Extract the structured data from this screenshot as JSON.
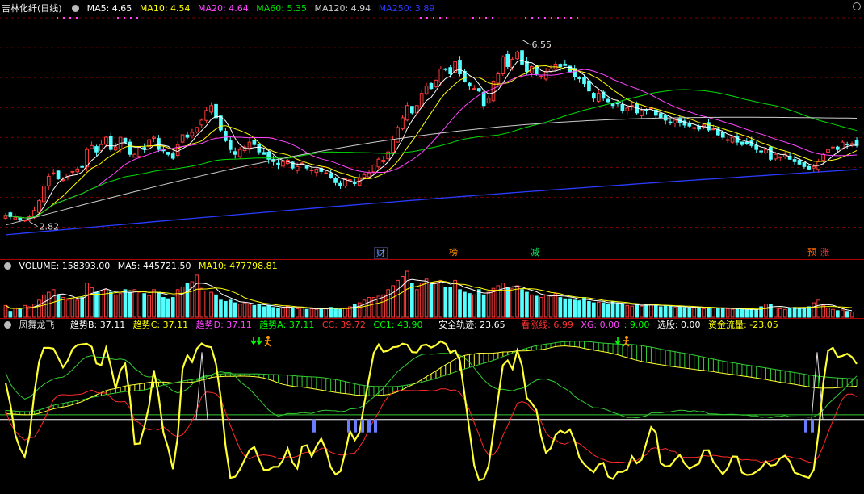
{
  "colors": {
    "up": "#ff3b3b",
    "down": "#54ffff",
    "ma5": "#ffffff",
    "ma10": "#ffff00",
    "ma20": "#ff44ff",
    "ma60": "#00dd00",
    "ma120": "#cccccc",
    "ma250": "#2a3cff",
    "grid": "#7a0000"
  },
  "price_panel": {
    "title": "吉林化纤(日线)",
    "ma5": "MA5: 4.65",
    "ma10": "MA10: 4.54",
    "ma20": "MA20: 4.64",
    "ma60": "MA60: 5.35",
    "ma120": "MA120: 4.94",
    "ma250": "MA250: 3.89",
    "high_label": "6.55",
    "low_label": "2.82",
    "events": [
      {
        "text": "财",
        "color": "#6aa0ff"
      },
      {
        "text": "榜",
        "color": "#ff8c00"
      },
      {
        "text": "减",
        "color": "#00ff66"
      },
      {
        "text": "预",
        "color": "#ff6600"
      },
      {
        "text": "涨",
        "color": "#ff3333"
      }
    ]
  },
  "volume_panel": {
    "label": "VOLUME: 158393.00",
    "ma5": "MA5: 445721.50",
    "ma10": "MA10: 477798.81"
  },
  "indicator_panel": {
    "name": "凤舞龙飞",
    "b": "趋势B: 37.11",
    "c": "趋势C: 37.11",
    "d": "趋势D: 37.11",
    "a": "趋势A: 37.11",
    "cc": "CC: 39.72",
    "cc1": "CC1: 43.90",
    "safe": "安全轨迹: 23.65",
    "bull": "看涨线: 6.99",
    "xg": "XG: 0.00",
    "blank": ": 9.00",
    "pick": "选股: 0.00",
    "fund": "资金流量: -23.05"
  },
  "chart_data": [
    {
      "type": "candlestick",
      "title": "吉林化纤(日线)",
      "closes": [
        2.95,
        2.92,
        2.9,
        2.86,
        2.85,
        2.92,
        3.05,
        3.25,
        3.55,
        3.75,
        3.82,
        3.7,
        3.68,
        3.8,
        3.85,
        3.9,
        3.95,
        4.3,
        4.38,
        4.25,
        4.4,
        4.55,
        4.3,
        4.35,
        4.55,
        4.45,
        4.2,
        4.2,
        4.35,
        4.3,
        4.5,
        4.55,
        4.3,
        4.28,
        4.2,
        4.12,
        4.4,
        4.6,
        4.55,
        4.65,
        4.75,
        4.9,
        5.1,
        5.2,
        4.95,
        4.7,
        4.48,
        4.3,
        4.2,
        4.3,
        4.35,
        4.45,
        4.4,
        4.25,
        4.2,
        4.1,
        4.05,
        3.98,
        4.05,
        4.08,
        3.92,
        3.95,
        4.02,
        3.92,
        3.88,
        3.9,
        3.85,
        3.82,
        3.72,
        3.62,
        3.55,
        3.7,
        3.68,
        3.6,
        3.72,
        3.78,
        3.82,
        3.98,
        4.1,
        4.08,
        4.25,
        4.5,
        4.75,
        4.95,
        5.2,
        5.05,
        5.2,
        5.45,
        5.6,
        5.55,
        5.72,
        5.95,
        5.95,
        5.85,
        6.1,
        5.85,
        5.7,
        5.6,
        5.55,
        5.5,
        5.2,
        5.35,
        5.7,
        5.85,
        6.2,
        6.0,
        6.15,
        6.3,
        6.05,
        5.9,
        6.0,
        5.85,
        5.8,
        5.9,
        5.95,
        6.05,
        6.0,
        6.02,
        5.9,
        5.8,
        5.75,
        5.65,
        5.5,
        5.35,
        5.45,
        5.35,
        5.28,
        5.2,
        5.25,
        5.1,
        5.15,
        5.2,
        5.05,
        5.1,
        5.1,
        5.15,
        5.0,
        4.95,
        4.9,
        4.85,
        4.9,
        4.85,
        4.8,
        4.78,
        4.75,
        4.72,
        4.8,
        4.7,
        4.72,
        4.6,
        4.55,
        4.5,
        4.55,
        4.45,
        4.4,
        4.42,
        4.38,
        4.3,
        4.25,
        4.3,
        4.1,
        4.2,
        4.15,
        4.2,
        4.1,
        4.05,
        4.0,
        3.95,
        3.9,
        3.95,
        4.05,
        4.2,
        4.3,
        4.35,
        4.3,
        4.45,
        4.4,
        4.42,
        4.38
      ],
      "high": 6.55,
      "low": 2.82,
      "ylim": [
        2.4,
        7.0
      ],
      "moving_averages": [
        "MA5",
        "MA10",
        "MA20",
        "MA60",
        "MA120",
        "MA250"
      ]
    },
    {
      "type": "bar",
      "title": "VOLUME",
      "volumes": [
        180,
        90,
        140,
        120,
        180,
        160,
        200,
        260,
        340,
        380,
        420,
        330,
        300,
        260,
        280,
        260,
        300,
        520,
        450,
        380,
        400,
        420,
        380,
        340,
        360,
        420,
        380,
        420,
        380,
        360,
        330,
        420,
        380,
        300,
        280,
        300,
        420,
        460,
        520,
        540,
        640,
        440,
        400,
        380,
        340,
        260,
        240,
        260,
        220,
        200,
        220,
        200,
        180,
        200,
        160,
        180,
        150,
        140,
        140,
        170,
        150,
        130,
        140,
        120,
        130,
        120,
        140,
        130,
        150,
        140,
        120,
        140,
        160,
        200,
        220,
        260,
        300,
        300,
        320,
        340,
        420,
        480,
        560,
        620,
        700,
        520,
        420,
        520,
        580,
        500,
        540,
        560,
        460,
        460,
        560,
        420,
        380,
        360,
        340,
        420,
        340,
        380,
        440,
        480,
        520,
        440,
        440,
        480,
        420,
        380,
        340,
        320,
        300,
        340,
        320,
        360,
        300,
        280,
        280,
        260,
        250,
        300,
        240,
        220,
        230,
        220,
        200,
        240,
        210,
        200,
        180,
        170,
        200,
        170,
        200,
        190,
        180,
        160,
        180,
        170,
        150,
        160,
        150,
        140,
        160,
        150,
        130,
        150,
        140,
        130,
        140,
        130,
        120,
        130,
        120,
        110,
        120,
        110,
        160,
        200,
        200,
        140,
        130,
        120,
        140,
        150,
        130,
        140,
        160,
        220,
        260,
        180,
        140,
        120,
        100,
        110,
        90,
        80
      ]
    },
    {
      "type": "line",
      "title": "凤舞龙飞",
      "series": [
        {
          "name": "趋势B",
          "color": "#ffff33"
        },
        {
          "name": "CC",
          "color": "#ff2a2a"
        },
        {
          "name": "CC1",
          "color": "#33cc33"
        },
        {
          "name": "安全轨迹",
          "color": "#ffffff"
        }
      ]
    }
  ]
}
